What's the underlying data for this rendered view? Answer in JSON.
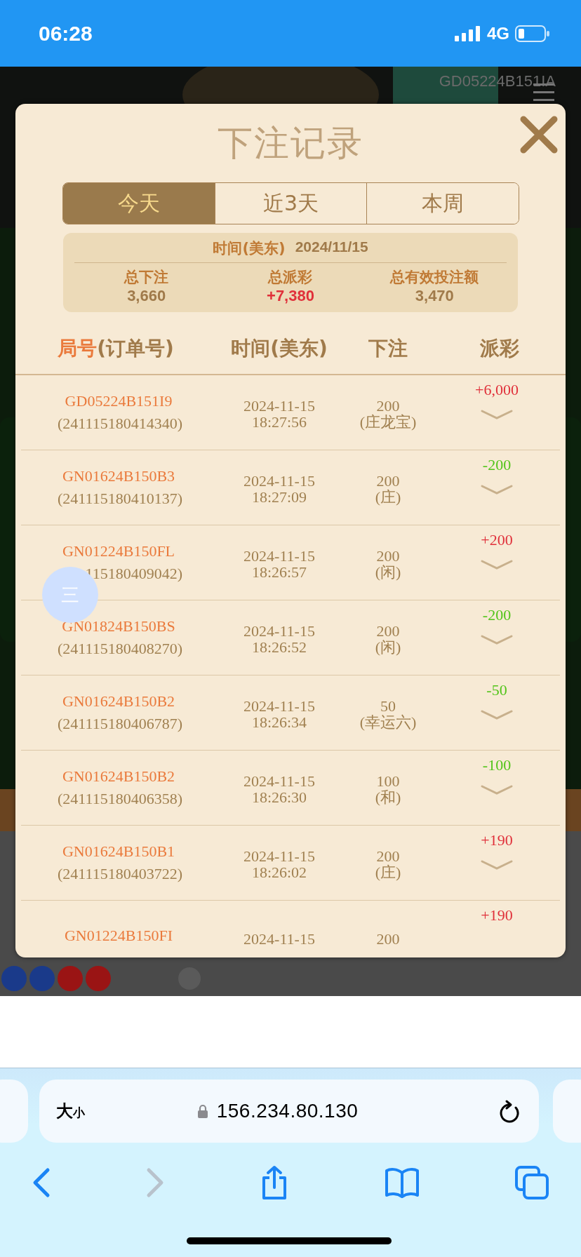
{
  "status_bar": {
    "time": "06:28",
    "network": "4G"
  },
  "game": {
    "round_id": "GD05224B151IA"
  },
  "modal": {
    "title": "下注记录",
    "tabs": [
      {
        "label": "今天",
        "selected": true
      },
      {
        "label": "近3天",
        "selected": false
      },
      {
        "label": "本周",
        "selected": false
      }
    ],
    "summary": {
      "date_label": "时间(美东)",
      "date": "2024/11/15",
      "stats": [
        {
          "label": "总下注",
          "value": "3,660",
          "color": "#a07a4a"
        },
        {
          "label": "总派彩",
          "value": "+7,380",
          "color": "#e0303a"
        },
        {
          "label": "总有效投注额",
          "value": "3,470",
          "color": "#a07a4a"
        }
      ]
    },
    "columns": [
      {
        "label": "局号",
        "suffix": "(订单号)"
      },
      {
        "label": "时间(美东)"
      },
      {
        "label": "下注"
      },
      {
        "label": "派彩"
      }
    ],
    "rows": [
      {
        "round": "GD05224B151I9",
        "order": "(241115180414340)",
        "date": "2024-11-15",
        "time": "18:27:56",
        "amount": "200",
        "bet": "(庄龙宝)",
        "payout": "+6,000",
        "color": "#e0303a"
      },
      {
        "round": "GN01624B150B3",
        "order": "(241115180410137)",
        "date": "2024-11-15",
        "time": "18:27:09",
        "amount": "200",
        "bet": "(庄)",
        "payout": "-200",
        "color": "#52c41a"
      },
      {
        "round": "GN01224B150FL",
        "order": "115180409042)",
        "date": "2024-11-15",
        "time": "18:26:57",
        "amount": "200",
        "bet": "(闲)",
        "payout": "+200",
        "color": "#e0303a"
      },
      {
        "round": "GN01824B150BS",
        "order": "(241115180408270)",
        "date": "2024-11-15",
        "time": "18:26:52",
        "amount": "200",
        "bet": "(闲)",
        "payout": "-200",
        "color": "#52c41a"
      },
      {
        "round": "GN01624B150B2",
        "order": "(241115180406787)",
        "date": "2024-11-15",
        "time": "18:26:34",
        "amount": "50",
        "bet": "(幸运六)",
        "payout": "-50",
        "color": "#52c41a"
      },
      {
        "round": "GN01624B150B2",
        "order": "(241115180406358)",
        "date": "2024-11-15",
        "time": "18:26:30",
        "amount": "100",
        "bet": "(和)",
        "payout": "-100",
        "color": "#52c41a"
      },
      {
        "round": "GN01624B150B1",
        "order": "(241115180403722)",
        "date": "2024-11-15",
        "time": "18:26:02",
        "amount": "200",
        "bet": "(庄)",
        "payout": "+190",
        "color": "#e0303a"
      },
      {
        "round": "GN01224B150FI",
        "date": "2024-11-15",
        "amount": "200",
        "payout": "+190",
        "color": "#e0303a"
      }
    ]
  },
  "floating_button": {
    "glyph": "三"
  },
  "browser": {
    "text_size": "大小",
    "url": "156.234.80.130"
  }
}
